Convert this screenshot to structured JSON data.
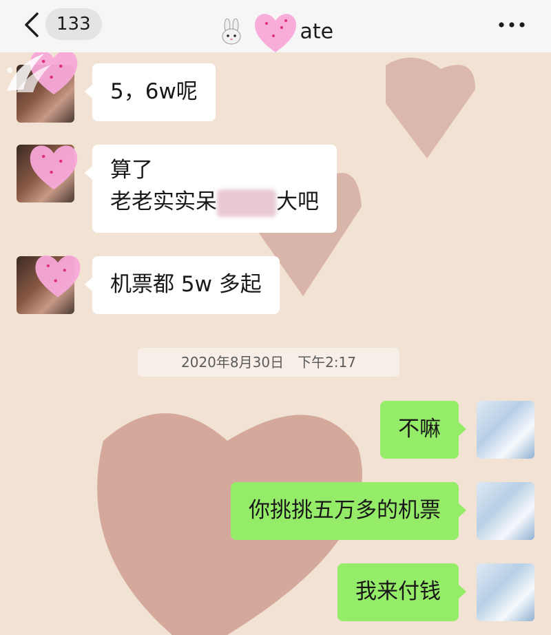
{
  "header": {
    "back_label": "<",
    "unread_count": "133",
    "contact_name_suffix": "ate",
    "more_label": "•••"
  },
  "messages": [
    {
      "direction": "in",
      "lines": [
        "5，6w呢"
      ]
    },
    {
      "direction": "in",
      "lines": [
        "算了",
        "老老实实呆",
        "大吧"
      ]
    },
    {
      "direction": "in",
      "lines": [
        "机票都 5w 多起"
      ]
    },
    {
      "direction": "out",
      "lines": [
        "不嘛"
      ]
    },
    {
      "direction": "out",
      "lines": [
        "你挑挑五万多的机票"
      ]
    },
    {
      "direction": "out",
      "lines": [
        "我来付钱"
      ]
    }
  ],
  "timestamp": "2020年8月30日　下午2:17",
  "colors": {
    "incoming_bubble": "#ffffff",
    "outgoing_bubble": "#95ec69",
    "chat_background": "#f1e2d4",
    "header_background": "#f6f6f6"
  },
  "icons": [
    "back-icon",
    "rabbit-emoji-icon",
    "more-icon",
    "watermark-logo",
    "heart-sticker-icon"
  ]
}
